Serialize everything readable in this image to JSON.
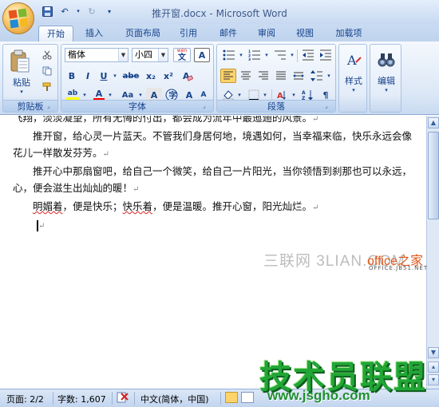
{
  "window": {
    "title": "推开窗.docx - Microsoft Word"
  },
  "tabs": [
    {
      "label": "开始",
      "active": true
    },
    {
      "label": "插入"
    },
    {
      "label": "页面布局"
    },
    {
      "label": "引用"
    },
    {
      "label": "邮件"
    },
    {
      "label": "审阅"
    },
    {
      "label": "视图"
    },
    {
      "label": "加载项"
    }
  ],
  "clipboard": {
    "paste_label": "粘贴",
    "group_label": "剪贴板"
  },
  "font": {
    "name_value": "楷体",
    "size_value": "小四",
    "group_label": "字体",
    "wen_label": "wén",
    "wen_char": "文",
    "bold": "B",
    "italic": "I",
    "underline": "U",
    "strike": "abe",
    "subscript": "x₂",
    "superscript": "x²",
    "aa_label": "Aa",
    "border_char": "A",
    "grow": "A",
    "shrink": "A"
  },
  "paragraph": {
    "group_label": "段落"
  },
  "styles": {
    "label": "样式"
  },
  "editing": {
    "label": "编辑"
  },
  "document": {
    "line0": "飞翔，淡淡凝望，所有无悔的付出，都会成为流年中最迤逦的风景。",
    "para1": "推开窗，给心灵一片蓝天。不管我们身居何地，境遇如何，当幸福来临，快乐永远会像花儿一样散发芬芳。",
    "para2": "推开心中那扇窗吧，给自己一个微笑，给自己一片阳光，当你领悟到刹那也可以永远，心，便会滋生出灿灿的暖！",
    "para3_a": "明媚着",
    "para3_b": "，便是快乐；",
    "para3_c": "快乐着",
    "para3_d": "，便是温暖。推开心窗，阳光灿烂。",
    "pmark": "↵"
  },
  "status": {
    "page": "页面: 2/2",
    "words": "字数: 1,607",
    "language": "中文(简体，中国)"
  },
  "watermarks": {
    "site_text": "三联网 3LIAN.COM",
    "office_text": "office之家",
    "office_sub": "OFFICE.JB51.NET",
    "big_text": "技术员联盟",
    "big_sub": "www.jsgho.com"
  },
  "colors": {
    "ribbon_text": "#15428b",
    "highlight": "#ffff00",
    "font_red": "#ff0000",
    "watermark_green": "#22a637"
  }
}
